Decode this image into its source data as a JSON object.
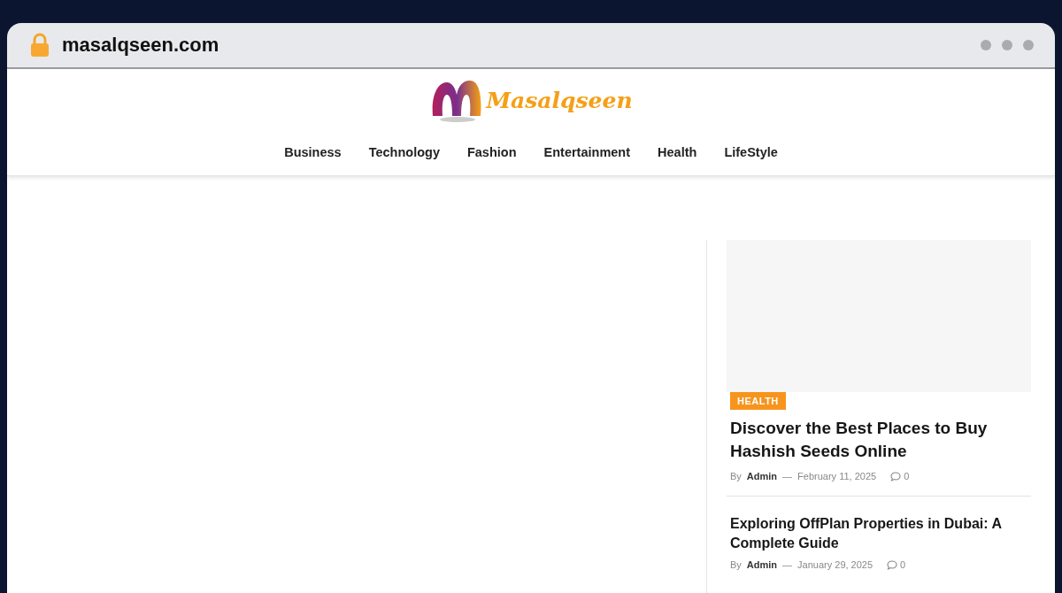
{
  "browser": {
    "url": "masalqseen.com"
  },
  "site": {
    "logo_text": "Masalqseen",
    "nav": [
      {
        "label": "Business"
      },
      {
        "label": "Technology"
      },
      {
        "label": "Fashion"
      },
      {
        "label": "Entertainment"
      },
      {
        "label": "Health"
      },
      {
        "label": "LifeStyle"
      }
    ]
  },
  "sidebar": {
    "posts": [
      {
        "kind": "featured",
        "category": "HEALTH",
        "title": "Discover the Best Places to Buy Hashish Seeds Online",
        "by": "By",
        "author": "Admin",
        "separator": "—",
        "date": "February 11, 2025",
        "comments": "0"
      },
      {
        "kind": "list",
        "title": "Exploring OffPlan Properties in Dubai: A Complete Guide",
        "by": "By",
        "author": "Admin",
        "separator": "—",
        "date": "January 29, 2025",
        "comments": "0"
      }
    ]
  }
}
